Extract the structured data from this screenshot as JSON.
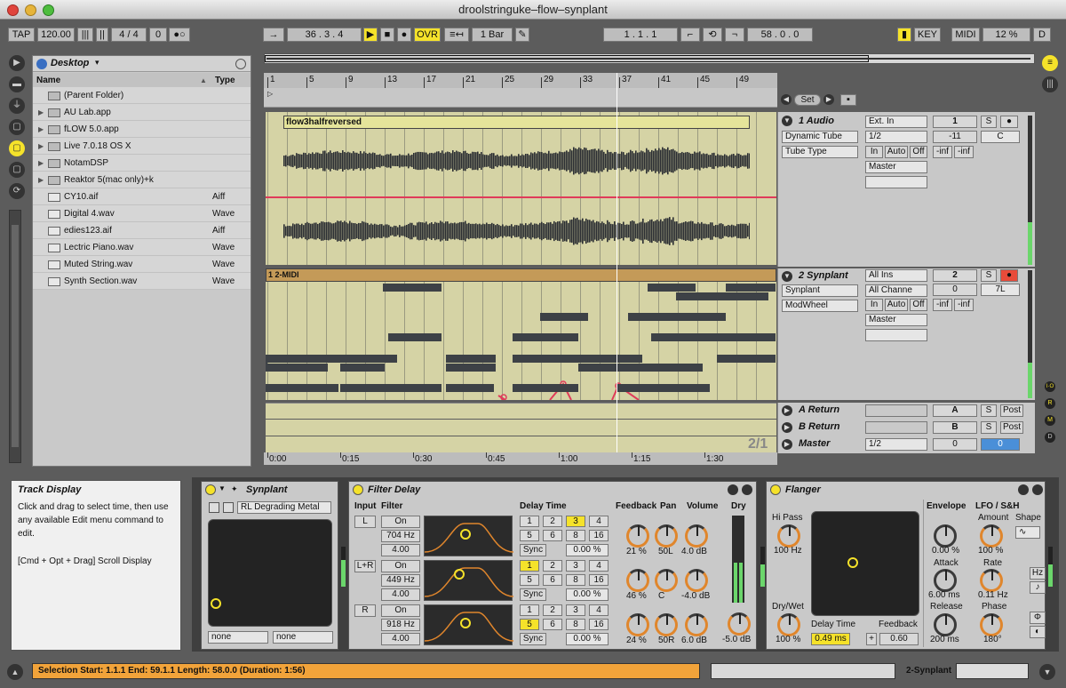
{
  "window": {
    "title": "droolstringuke–flow–synplant"
  },
  "transport": {
    "tap": "TAP",
    "tempo": "120.00",
    "signature": "4 / 4",
    "groove": "0",
    "position": "36 .   3 .   4",
    "ovr": "OVR",
    "quantize": "1 Bar",
    "loop_start": "1 .   1 .   1",
    "loop_length": "58 .   0 .   0",
    "key": "KEY",
    "midi": "MIDI",
    "cpu": "12 %",
    "disk": "D"
  },
  "browser": {
    "location": "Desktop",
    "col_name": "Name",
    "col_type": "Type",
    "items": [
      {
        "name": "(Parent Folder)",
        "type": "",
        "kind": "parent"
      },
      {
        "name": "AU Lab.app",
        "type": "",
        "kind": "folder"
      },
      {
        "name": "fLOW 5.0.app",
        "type": "",
        "kind": "folder"
      },
      {
        "name": "Live 7.0.18 OS X",
        "type": "",
        "kind": "folder"
      },
      {
        "name": "NotamDSP",
        "type": "",
        "kind": "folder"
      },
      {
        "name": "Reaktor 5(mac only)+k",
        "type": "",
        "kind": "folder"
      },
      {
        "name": "CY10.aif",
        "type": "Aiff",
        "kind": "file"
      },
      {
        "name": "Digital 4.wav",
        "type": "Wave",
        "kind": "file"
      },
      {
        "name": "edies123.aif",
        "type": "Aiff",
        "kind": "file"
      },
      {
        "name": "Lectric Piano.wav",
        "type": "Wave",
        "kind": "file"
      },
      {
        "name": "Muted String.wav",
        "type": "Wave",
        "kind": "file"
      },
      {
        "name": "Synth Section.wav",
        "type": "Wave",
        "kind": "file"
      }
    ]
  },
  "arrangement": {
    "bar_ruler": [
      "1",
      "5",
      "9",
      "13",
      "17",
      "21",
      "25",
      "29",
      "33",
      "37",
      "41",
      "45",
      "49"
    ],
    "time_ruler": [
      "0:00",
      "0:15",
      "0:30",
      "0:45",
      "1:00",
      "1:15",
      "1:30"
    ],
    "set_label": "Set",
    "audio_clip": "flow3halfreversed",
    "midi_clip": "1 2-MIDI",
    "zoom": "2/1"
  },
  "tracks": {
    "audio": {
      "name": "1 Audio",
      "device1": "Dynamic Tube",
      "device2": "Tube Type",
      "input": "Ext. In",
      "channel": "1/2",
      "in": "In",
      "auto": "Auto",
      "off": "Off",
      "output": "Master",
      "number": "1",
      "solo": "S",
      "volume": "-11",
      "pan": "C",
      "peak_l": "-inf",
      "peak_r": "-inf"
    },
    "synplant": {
      "name": "2 Synplant",
      "device1": "Synplant",
      "device2": "ModWheel",
      "input": "All Ins",
      "channel": "All Channe",
      "in": "In",
      "auto": "Auto",
      "off": "Off",
      "output": "Master",
      "number": "2",
      "solo": "S",
      "volume": "0",
      "pan": "7L",
      "peak_l": "-inf",
      "peak_r": "-inf"
    },
    "ret_a": {
      "name": "A Return",
      "letter": "A",
      "solo": "S",
      "post": "Post"
    },
    "ret_b": {
      "name": "B Return",
      "letter": "B",
      "solo": "S",
      "post": "Post"
    },
    "master": {
      "name": "Master",
      "channel": "1/2",
      "volume": "0",
      "pan": "0"
    }
  },
  "info": {
    "title": "Track Display",
    "line1": "Click and drag to select time, then use any available Edit menu command to edit.",
    "line2": "[Cmd + Opt + Drag] Scroll Display"
  },
  "synplant_dev": {
    "title": "Synplant",
    "preset": "RL Degrading Metal",
    "sel1": "none",
    "sel2": "none"
  },
  "filter_delay": {
    "title": "Filter Delay",
    "input_lbl": "Input",
    "filter_lbl": "Filter",
    "delay_lbl": "Delay Time",
    "fb_lbl": "Feedback",
    "pan_lbl": "Pan",
    "vol_lbl": "Volume",
    "dry_lbl": "Dry",
    "rows": [
      {
        "ch": "L",
        "on": "On",
        "freq": "704 Hz",
        "q": "4.00",
        "sync": "Sync",
        "offset": "0.00 %",
        "fb": "21 %",
        "pan": "50L",
        "vol": "4.0 dB"
      },
      {
        "ch": "L+R",
        "on": "On",
        "freq": "449 Hz",
        "q": "4.00",
        "sync": "Sync",
        "offset": "0.00 %",
        "fb": "46 %",
        "pan": "C",
        "vol": "-4.0 dB"
      },
      {
        "ch": "R",
        "on": "On",
        "freq": "918 Hz",
        "q": "4.00",
        "sync": "Sync",
        "offset": "0.00 %",
        "fb": "24 %",
        "pan": "50R",
        "vol": "6.0 dB"
      }
    ],
    "delay_buttons": [
      "1",
      "2",
      "3",
      "4",
      "5",
      "6",
      "8",
      "16"
    ],
    "dry": "-5.0 dB"
  },
  "flanger": {
    "title": "Flanger",
    "hipass_lbl": "Hi Pass",
    "hipass": "100 Hz",
    "drywet_lbl": "Dry/Wet",
    "drywet": "100 %",
    "delay_lbl": "Delay Time",
    "delay": "0.49 ms",
    "fb_lbl": "Feedback",
    "fb": "0.60",
    "plus": "+",
    "env_lbl": "Envelope",
    "env": "0.00 %",
    "attack_lbl": "Attack",
    "attack": "6.00 ms",
    "release_lbl": "Release",
    "release": "200 ms",
    "lfo_lbl": "LFO / S&H",
    "amount_lbl": "Amount",
    "amount": "100 %",
    "rate_lbl": "Rate",
    "rate": "0.11 Hz",
    "phase_lbl": "Phase",
    "phase": "180°",
    "shape_lbl": "Shape",
    "hz": "Hz"
  },
  "status": {
    "text": "Selection Start: 1.1.1   End: 59.1.1   Length: 58.0.0   (Duration: 1:56)",
    "track": "2-Synplant"
  },
  "side_letters": [
    "I·O",
    "R",
    "M",
    "D"
  ]
}
